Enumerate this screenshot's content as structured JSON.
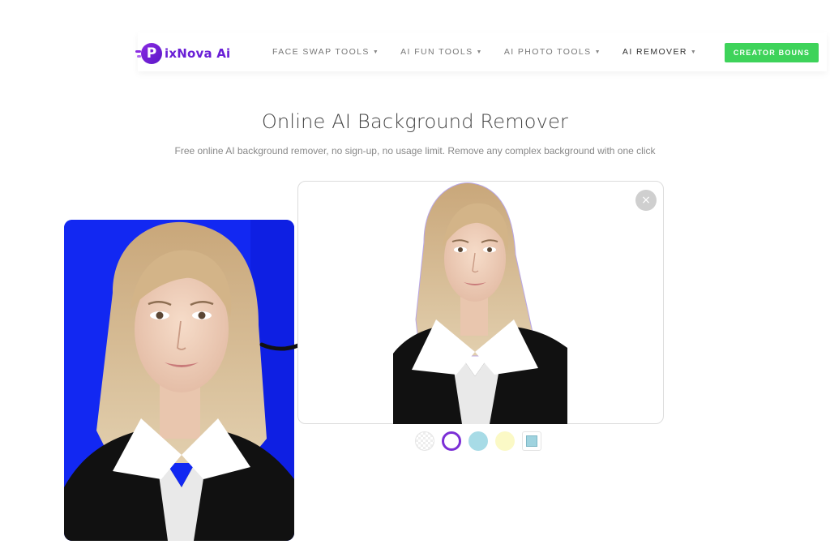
{
  "brand": {
    "logo_letter": "P",
    "name": "ixNova Ai",
    "colors": {
      "primary": "#6a1fd6",
      "cta": "#3ed35a"
    }
  },
  "nav": {
    "items": [
      {
        "label": "FACE SWAP TOOLS"
      },
      {
        "label": "AI FUN TOOLS"
      },
      {
        "label": "AI PHOTO TOOLS"
      },
      {
        "label": "AI REMOVER"
      }
    ],
    "caret_icon": "caret-down-icon",
    "cta_label": "CREATOR BOUNS"
  },
  "hero": {
    "title": "Online AI Background Remover",
    "subtitle": "Free online AI background remover, no sign-up, no usage limit. Remove any complex background with one click"
  },
  "demo": {
    "original_background_color": "#1228f2",
    "close_icon": "close-icon",
    "close_glyph": "×",
    "arrow_icon": "curved-arrow-icon"
  },
  "swatches": [
    {
      "name": "transparent",
      "color": "transparent"
    },
    {
      "name": "white",
      "color": "#ffffff",
      "selected": true
    },
    {
      "name": "light-blue",
      "color": "#a7dbe6"
    },
    {
      "name": "light-yellow",
      "color": "#fbf9c6"
    },
    {
      "name": "image",
      "color": "#9fd3df"
    }
  ]
}
